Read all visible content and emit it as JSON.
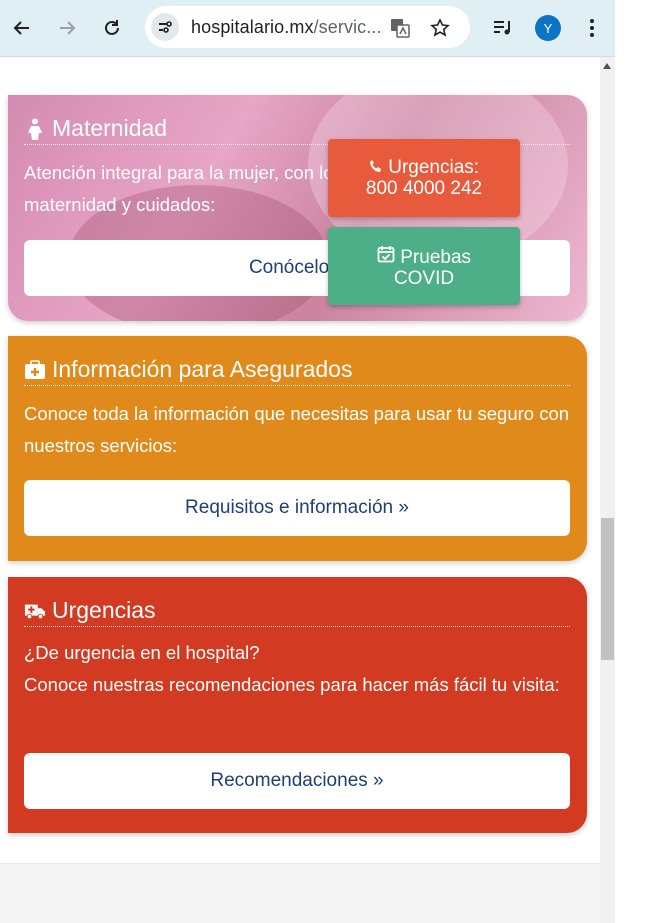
{
  "browser": {
    "url_host": "hospitalario.mx",
    "url_path": "/servic...",
    "avatar_letter": "Y",
    "icons": [
      "back-icon",
      "forward-icon",
      "reload-icon",
      "site-info-icon",
      "translate-icon",
      "bookmark-star-icon",
      "media-control-icon",
      "profile-avatar",
      "more-menu-icon"
    ]
  },
  "cards": {
    "maternidad": {
      "title": "Maternidad",
      "text": "Atención integral para la mujer, con los mejores servicios de maternidad y cuidados:",
      "button": "Conócelo »",
      "icon": "female-icon"
    },
    "asegurados": {
      "title": "Información para Asegurados",
      "text": "Conoce toda la información que necesitas para usar tu seguro con nuestros servicios:",
      "button": "Requisitos e información »",
      "icon": "medkit-icon",
      "color": "#e08a1c"
    },
    "urgencias": {
      "title": "Urgencias",
      "text_line1": "¿De urgencia en el hospital?",
      "text_line2": "Conoce nuestras recomendaciones para hacer más fácil tu visita:",
      "button": "Recomendaciones »",
      "icon": "ambulance-icon",
      "color": "#d23a22"
    }
  },
  "floating": {
    "urgencias_label": "Urgencias:",
    "urgencias_phone": "800 4000 242",
    "covid_line1": "Pruebas",
    "covid_line2": "COVID",
    "urgencias_color": "#e85a3c",
    "covid_color": "#4caf87"
  }
}
